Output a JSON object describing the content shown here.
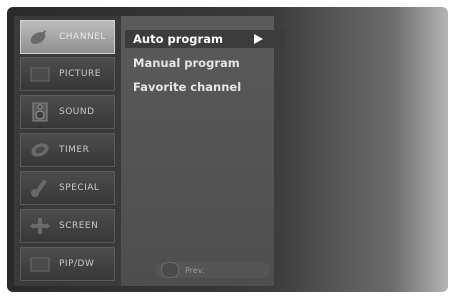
{
  "sidebar": {
    "items": [
      {
        "label": "CHANNEL",
        "icon": "satellite-icon",
        "active": true
      },
      {
        "label": "PICTURE",
        "icon": "picture-icon",
        "active": false
      },
      {
        "label": "SOUND",
        "icon": "speaker-icon",
        "active": false
      },
      {
        "label": "TIMER",
        "icon": "clock-icon",
        "active": false
      },
      {
        "label": "SPECIAL",
        "icon": "wrench-icon",
        "active": false
      },
      {
        "label": "SCREEN",
        "icon": "screen-icon",
        "active": false
      },
      {
        "label": "PIP/DW",
        "icon": "pip-icon",
        "active": false
      }
    ]
  },
  "menu": {
    "items": [
      {
        "label": "Auto program",
        "selected": true
      },
      {
        "label": "Manual program",
        "selected": false
      },
      {
        "label": "Favorite channel",
        "selected": false
      }
    ]
  },
  "hint": {
    "label": "Prev."
  }
}
